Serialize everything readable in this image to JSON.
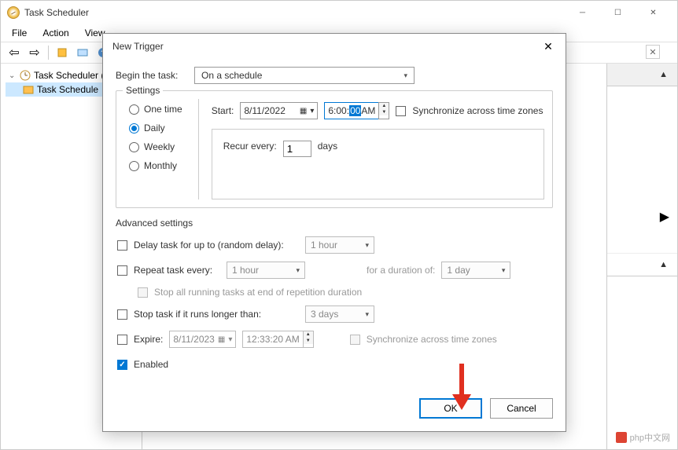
{
  "main_window": {
    "title": "Task Scheduler",
    "menu": {
      "file": "File",
      "action": "Action",
      "view": "View"
    },
    "tree": {
      "root": "Task Scheduler (L",
      "child": "Task Schedule"
    }
  },
  "dialog": {
    "title": "New Trigger",
    "begin_label": "Begin the task:",
    "begin_value": "On a schedule",
    "settings_legend": "Settings",
    "radios": {
      "one_time": "One time",
      "daily": "Daily",
      "weekly": "Weekly",
      "monthly": "Monthly"
    },
    "start_label": "Start:",
    "start_date": "8/11/2022",
    "start_time_h": "6:00:",
    "start_time_sel": "00",
    "start_time_ampm": " AM",
    "sync_tz": "Synchronize across time zones",
    "recur_label": "Recur every:",
    "recur_value": "1",
    "recur_unit": "days",
    "adv_legend": "Advanced settings",
    "delay_label": "Delay task for up to (random delay):",
    "delay_value": "1 hour",
    "repeat_label": "Repeat task every:",
    "repeat_value": "1 hour",
    "duration_label": "for a duration of:",
    "duration_value": "1 day",
    "stop_running": "Stop all running tasks at end of repetition duration",
    "stop_longer": "Stop task if it runs longer than:",
    "stop_longer_value": "3 days",
    "expire_label": "Expire:",
    "expire_date": "8/11/2023",
    "expire_time": "12:33:20 AM",
    "expire_sync": "Synchronize across time zones",
    "enabled_label": "Enabled",
    "ok": "OK",
    "cancel": "Cancel"
  },
  "watermark": "php中文网"
}
